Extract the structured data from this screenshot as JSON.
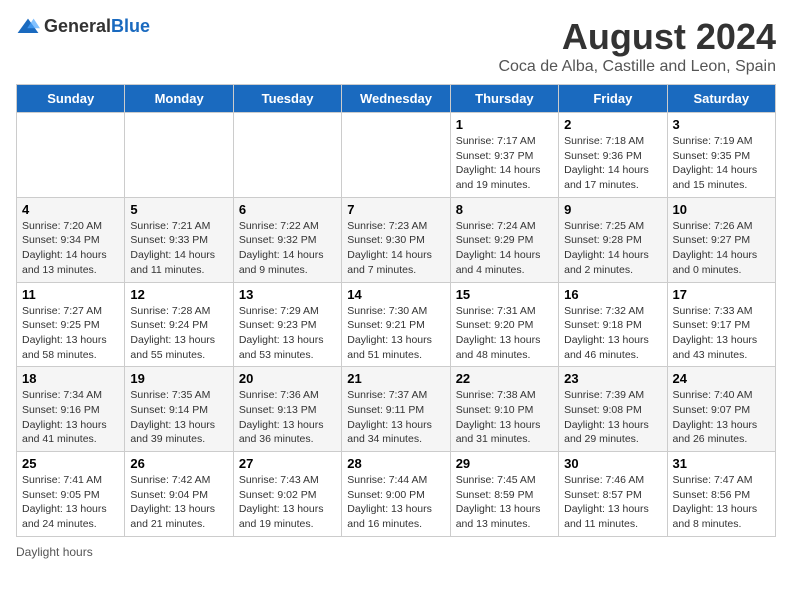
{
  "header": {
    "logo_general": "General",
    "logo_blue": "Blue",
    "month_title": "August 2024",
    "subtitle": "Coca de Alba, Castille and Leon, Spain"
  },
  "days_of_week": [
    "Sunday",
    "Monday",
    "Tuesday",
    "Wednesday",
    "Thursday",
    "Friday",
    "Saturday"
  ],
  "weeks": [
    [
      {
        "day": "",
        "info": ""
      },
      {
        "day": "",
        "info": ""
      },
      {
        "day": "",
        "info": ""
      },
      {
        "day": "",
        "info": ""
      },
      {
        "day": "1",
        "info": "Sunrise: 7:17 AM\nSunset: 9:37 PM\nDaylight: 14 hours\nand 19 minutes."
      },
      {
        "day": "2",
        "info": "Sunrise: 7:18 AM\nSunset: 9:36 PM\nDaylight: 14 hours\nand 17 minutes."
      },
      {
        "day": "3",
        "info": "Sunrise: 7:19 AM\nSunset: 9:35 PM\nDaylight: 14 hours\nand 15 minutes."
      }
    ],
    [
      {
        "day": "4",
        "info": "Sunrise: 7:20 AM\nSunset: 9:34 PM\nDaylight: 14 hours\nand 13 minutes."
      },
      {
        "day": "5",
        "info": "Sunrise: 7:21 AM\nSunset: 9:33 PM\nDaylight: 14 hours\nand 11 minutes."
      },
      {
        "day": "6",
        "info": "Sunrise: 7:22 AM\nSunset: 9:32 PM\nDaylight: 14 hours\nand 9 minutes."
      },
      {
        "day": "7",
        "info": "Sunrise: 7:23 AM\nSunset: 9:30 PM\nDaylight: 14 hours\nand 7 minutes."
      },
      {
        "day": "8",
        "info": "Sunrise: 7:24 AM\nSunset: 9:29 PM\nDaylight: 14 hours\nand 4 minutes."
      },
      {
        "day": "9",
        "info": "Sunrise: 7:25 AM\nSunset: 9:28 PM\nDaylight: 14 hours\nand 2 minutes."
      },
      {
        "day": "10",
        "info": "Sunrise: 7:26 AM\nSunset: 9:27 PM\nDaylight: 14 hours\nand 0 minutes."
      }
    ],
    [
      {
        "day": "11",
        "info": "Sunrise: 7:27 AM\nSunset: 9:25 PM\nDaylight: 13 hours\nand 58 minutes."
      },
      {
        "day": "12",
        "info": "Sunrise: 7:28 AM\nSunset: 9:24 PM\nDaylight: 13 hours\nand 55 minutes."
      },
      {
        "day": "13",
        "info": "Sunrise: 7:29 AM\nSunset: 9:23 PM\nDaylight: 13 hours\nand 53 minutes."
      },
      {
        "day": "14",
        "info": "Sunrise: 7:30 AM\nSunset: 9:21 PM\nDaylight: 13 hours\nand 51 minutes."
      },
      {
        "day": "15",
        "info": "Sunrise: 7:31 AM\nSunset: 9:20 PM\nDaylight: 13 hours\nand 48 minutes."
      },
      {
        "day": "16",
        "info": "Sunrise: 7:32 AM\nSunset: 9:18 PM\nDaylight: 13 hours\nand 46 minutes."
      },
      {
        "day": "17",
        "info": "Sunrise: 7:33 AM\nSunset: 9:17 PM\nDaylight: 13 hours\nand 43 minutes."
      }
    ],
    [
      {
        "day": "18",
        "info": "Sunrise: 7:34 AM\nSunset: 9:16 PM\nDaylight: 13 hours\nand 41 minutes."
      },
      {
        "day": "19",
        "info": "Sunrise: 7:35 AM\nSunset: 9:14 PM\nDaylight: 13 hours\nand 39 minutes."
      },
      {
        "day": "20",
        "info": "Sunrise: 7:36 AM\nSunset: 9:13 PM\nDaylight: 13 hours\nand 36 minutes."
      },
      {
        "day": "21",
        "info": "Sunrise: 7:37 AM\nSunset: 9:11 PM\nDaylight: 13 hours\nand 34 minutes."
      },
      {
        "day": "22",
        "info": "Sunrise: 7:38 AM\nSunset: 9:10 PM\nDaylight: 13 hours\nand 31 minutes."
      },
      {
        "day": "23",
        "info": "Sunrise: 7:39 AM\nSunset: 9:08 PM\nDaylight: 13 hours\nand 29 minutes."
      },
      {
        "day": "24",
        "info": "Sunrise: 7:40 AM\nSunset: 9:07 PM\nDaylight: 13 hours\nand 26 minutes."
      }
    ],
    [
      {
        "day": "25",
        "info": "Sunrise: 7:41 AM\nSunset: 9:05 PM\nDaylight: 13 hours\nand 24 minutes."
      },
      {
        "day": "26",
        "info": "Sunrise: 7:42 AM\nSunset: 9:04 PM\nDaylight: 13 hours\nand 21 minutes."
      },
      {
        "day": "27",
        "info": "Sunrise: 7:43 AM\nSunset: 9:02 PM\nDaylight: 13 hours\nand 19 minutes."
      },
      {
        "day": "28",
        "info": "Sunrise: 7:44 AM\nSunset: 9:00 PM\nDaylight: 13 hours\nand 16 minutes."
      },
      {
        "day": "29",
        "info": "Sunrise: 7:45 AM\nSunset: 8:59 PM\nDaylight: 13 hours\nand 13 minutes."
      },
      {
        "day": "30",
        "info": "Sunrise: 7:46 AM\nSunset: 8:57 PM\nDaylight: 13 hours\nand 11 minutes."
      },
      {
        "day": "31",
        "info": "Sunrise: 7:47 AM\nSunset: 8:56 PM\nDaylight: 13 hours\nand 8 minutes."
      }
    ]
  ],
  "footer": {
    "daylight_label": "Daylight hours"
  }
}
